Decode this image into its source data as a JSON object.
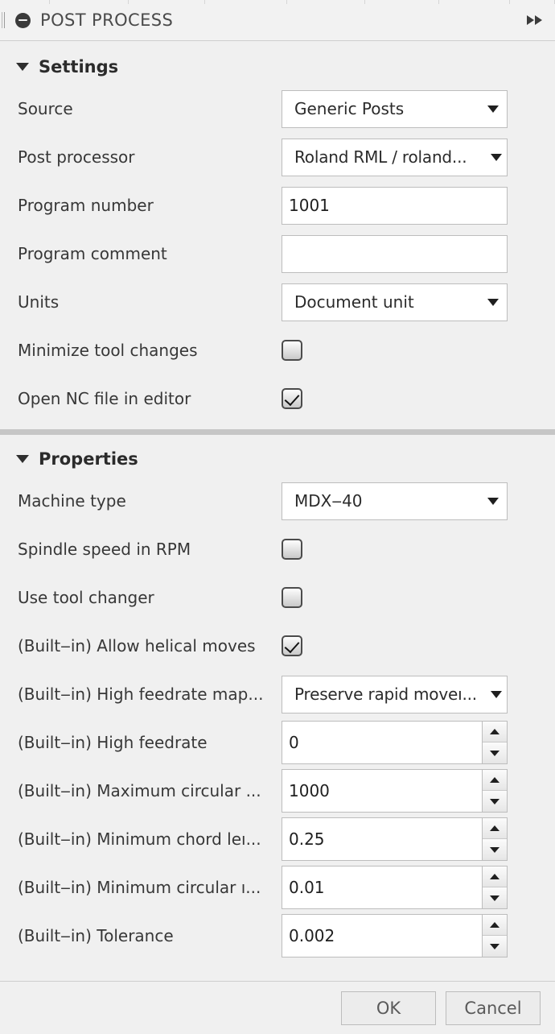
{
  "titlebar": {
    "title": "POST PROCESS",
    "collapse_icon": "minus-circle-icon",
    "forward_icon": "fast-forward-icon",
    "grip_icon": "drag-grip-icon"
  },
  "settings": {
    "section_label": "Settings",
    "rows": [
      {
        "label": "Source",
        "type": "combo",
        "value": "Generic Posts"
      },
      {
        "label": "Post processor",
        "type": "combo",
        "value": "Roland RML / roland..."
      },
      {
        "label": "Program number",
        "type": "text",
        "value": "1001"
      },
      {
        "label": "Program comment",
        "type": "text",
        "value": ""
      },
      {
        "label": "Units",
        "type": "combo",
        "value": "Document unit"
      },
      {
        "label": "Minimize tool changes",
        "type": "checkbox",
        "value": "unchecked"
      },
      {
        "label": "Open NC file in editor",
        "type": "checkbox",
        "value": "checked"
      }
    ]
  },
  "properties": {
    "section_label": "Properties",
    "rows": [
      {
        "label": "Machine type",
        "type": "combo",
        "value": "MDX‒40"
      },
      {
        "label": "Spindle speed in RPM",
        "type": "checkbox",
        "value": "unchecked"
      },
      {
        "label": "Use tool changer",
        "type": "checkbox",
        "value": "unchecked"
      },
      {
        "label": "(Built‒in) Allow helical moves",
        "type": "checkbox",
        "value": "checked"
      },
      {
        "label": "(Built‒in) High feedrate map...",
        "type": "combo",
        "value": "Preserve rapid moveı..."
      },
      {
        "label": "(Built‒in) High feedrate",
        "type": "spin",
        "value": "0"
      },
      {
        "label": "(Built‒in) Maximum circular ...",
        "type": "spin",
        "value": "1000"
      },
      {
        "label": "(Built‒in) Minimum chord leı...",
        "type": "spin",
        "value": "0.25"
      },
      {
        "label": "(Built‒in) Minimum circular ı...",
        "type": "spin",
        "value": "0.01"
      },
      {
        "label": "(Built‒in) Tolerance",
        "type": "spin",
        "value": "0.002"
      }
    ]
  },
  "footer": {
    "ok_label": "OK",
    "cancel_label": "Cancel"
  },
  "colors": {
    "window_bg": "#f0f0f0",
    "field_bg": "#ffffff",
    "field_border": "#bdbdbd",
    "label_text": "#373737",
    "separator": "#c6c6c6"
  }
}
